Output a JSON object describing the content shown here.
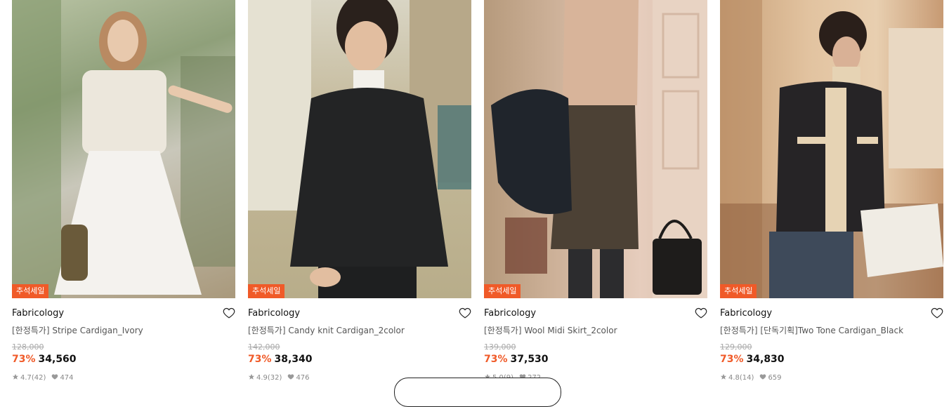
{
  "products": [
    {
      "badge": "추석세일",
      "brand": "Fabricology",
      "title": "[한정특가] Stripe Cardigan_Ivory",
      "original_price": "128,000",
      "discount": "73%",
      "price": "34,560",
      "rating": "4.7",
      "reviews": "(42)",
      "likes": "474"
    },
    {
      "badge": "추석세일",
      "brand": "Fabricology",
      "title": "[한정특가] Candy knit Cardigan_2color",
      "original_price": "142,000",
      "discount": "73%",
      "price": "38,340",
      "rating": "4.9",
      "reviews": "(32)",
      "likes": "476"
    },
    {
      "badge": "추석세일",
      "brand": "Fabricology",
      "title": "[한정특가] Wool Midi Skirt_2color",
      "original_price": "139,000",
      "discount": "73%",
      "price": "37,530",
      "rating": "5.0",
      "reviews": "(9)",
      "likes": "272"
    },
    {
      "badge": "추석세일",
      "brand": "Fabricology",
      "title": "[한정특가] [단독기획]Two Tone Cardigan_Black",
      "original_price": "129,000",
      "discount": "73%",
      "price": "34,830",
      "rating": "4.8",
      "reviews": "(14)",
      "likes": "659"
    }
  ],
  "colors": {
    "accent": "#f05a28",
    "text": "#111111",
    "muted": "#888888"
  },
  "icons": {
    "like": "heart-outline-icon",
    "rating": "star-icon",
    "likes": "heart-filled-icon"
  }
}
